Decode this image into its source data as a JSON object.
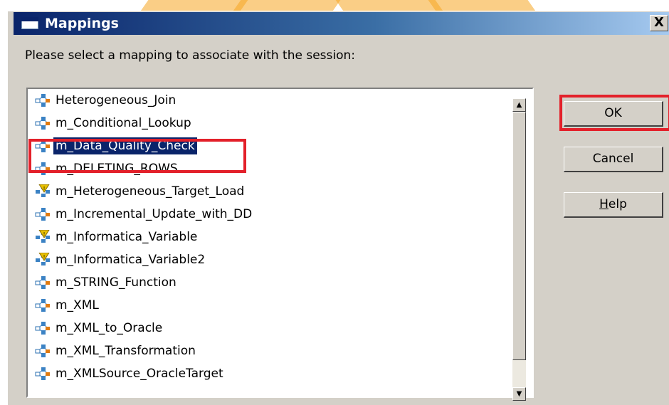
{
  "window": {
    "title": "Mappings",
    "close_glyph": "X"
  },
  "prompt": "Please select a mapping to associate with the session:",
  "mappings": [
    {
      "label": "Heterogeneous_Join",
      "icon": "mapping-icon"
    },
    {
      "label": "m_Conditional_Lookup",
      "icon": "mapping-icon"
    },
    {
      "label": "m_Data_Quality_Check",
      "icon": "mapping-icon",
      "selected": true
    },
    {
      "label": "m_DELETING_ROWS",
      "icon": "mapping-icon"
    },
    {
      "label": "m_Heterogeneous_Target_Load",
      "icon": "mapping-invalid-icon"
    },
    {
      "label": "m_Incremental_Update_with_DD",
      "icon": "mapping-icon"
    },
    {
      "label": "m_Informatica_Variable",
      "icon": "mapping-invalid-icon"
    },
    {
      "label": "m_Informatica_Variable2",
      "icon": "mapping-invalid-icon"
    },
    {
      "label": "m_STRING_Function",
      "icon": "mapping-icon"
    },
    {
      "label": "m_XML",
      "icon": "mapping-icon"
    },
    {
      "label": "m_XML_to_Oracle",
      "icon": "mapping-icon"
    },
    {
      "label": "m_XML_Transformation",
      "icon": "mapping-icon"
    },
    {
      "label": "m_XMLSource_OracleTarget",
      "icon": "mapping-icon"
    }
  ],
  "buttons": {
    "ok": "OK",
    "cancel": "Cancel",
    "help": "Help"
  },
  "colors": {
    "selection": "#0a246a",
    "highlight_box": "#e3202a",
    "dialog_face": "#d4d0c8"
  }
}
